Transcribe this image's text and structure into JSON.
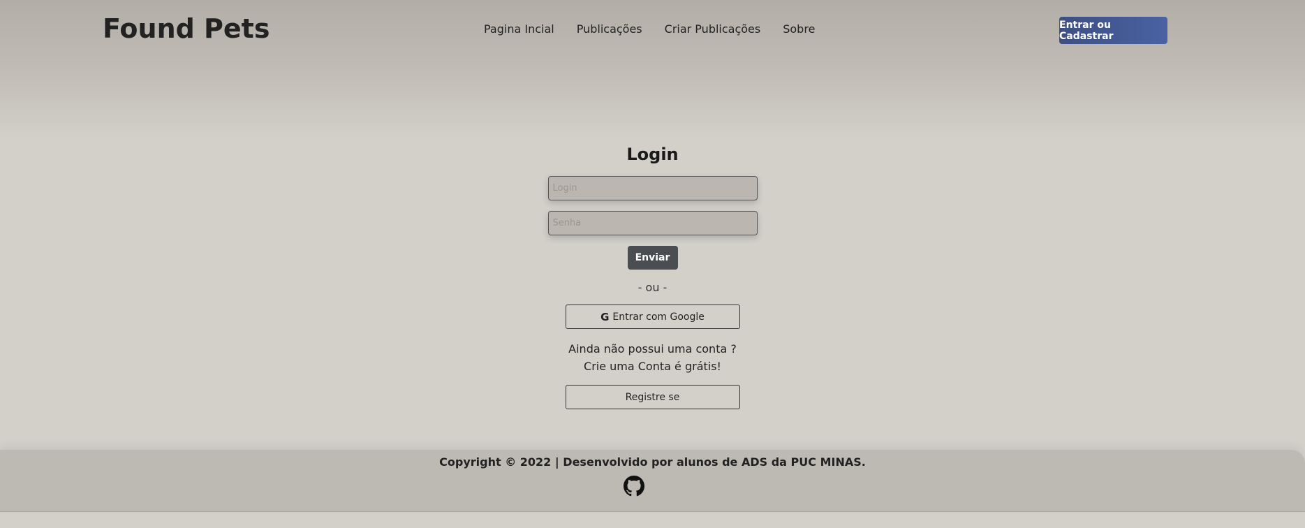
{
  "header": {
    "brand": "Found Pets",
    "nav": [
      "Pagina Incial",
      "Publicações",
      "Criar Publicações",
      "Sobre"
    ],
    "cta_label": "Entrar ou Cadastrar",
    "cta_color": "#3d4f83"
  },
  "login": {
    "title": "Login",
    "login_placeholder": "Login",
    "password_placeholder": "Senha",
    "submit_label": "Enviar",
    "separator": "- ou -",
    "google_icon": "google-g-icon",
    "google_label": "Entrar com Google",
    "no_account_line1": "Ainda não possui uma conta ?",
    "no_account_line2": "Crie uma Conta é grátis!",
    "register_label": "Registre se"
  },
  "footer": {
    "copyright": "Copyright © 2022 | Desenvolvido por alunos de ADS da PUC MINAS.",
    "github_icon": "github-icon"
  }
}
